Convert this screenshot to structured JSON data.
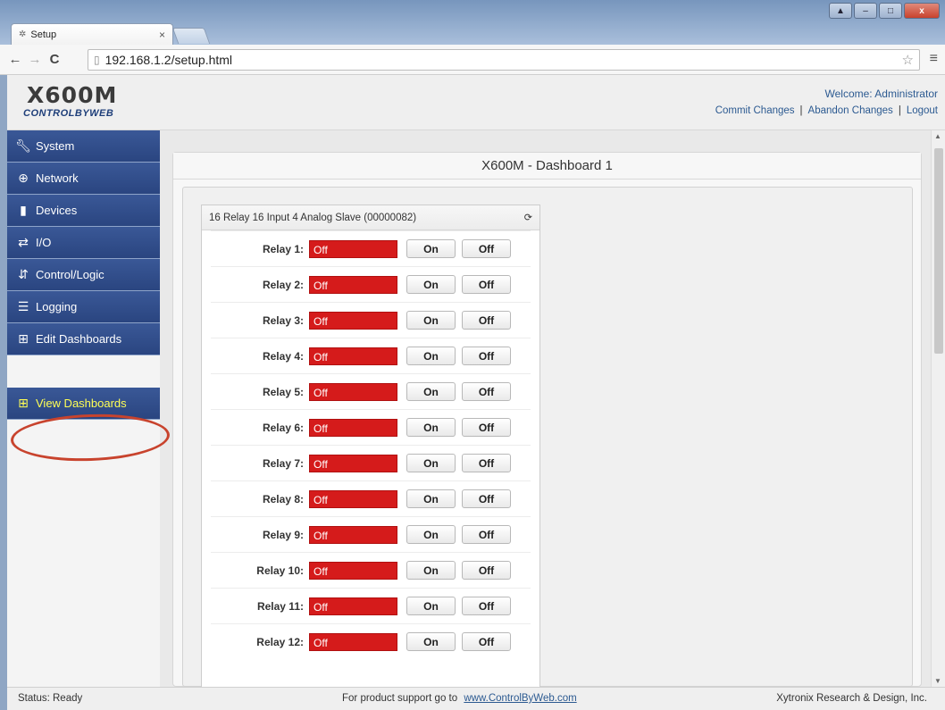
{
  "browser": {
    "tab_title": "Setup",
    "tab_close": "×",
    "url": "192.168.1.2/setup.html",
    "win_controls": [
      "▲",
      "–",
      "□",
      "x"
    ]
  },
  "header": {
    "logo_model": "X600M",
    "logo_brand": "CONTROLBYWEB",
    "welcome": "Welcome: Administrator",
    "links": [
      "Commit Changes",
      "Abandon Changes",
      "Logout"
    ],
    "separator": "|"
  },
  "sidebar": {
    "items": [
      {
        "label": "System",
        "icon": "wrench-icon"
      },
      {
        "label": "Network",
        "icon": "globe-icon"
      },
      {
        "label": "Devices",
        "icon": "device-icon"
      },
      {
        "label": "I/O",
        "icon": "io-arrows-icon"
      },
      {
        "label": "Control/Logic",
        "icon": "logic-icon"
      },
      {
        "label": "Logging",
        "icon": "log-icon"
      },
      {
        "label": "Edit Dashboards",
        "icon": "dashboard-icon"
      }
    ],
    "view_dashboards": {
      "label": "View Dashboards",
      "icon": "dashboard-icon"
    }
  },
  "dashboard": {
    "title": "X600M - Dashboard 1",
    "widget_title": "16 Relay 16 Input 4 Analog Slave (00000082)",
    "relays": [
      {
        "label": "Relay 1:",
        "state": "Off"
      },
      {
        "label": "Relay 2:",
        "state": "Off"
      },
      {
        "label": "Relay 3:",
        "state": "Off"
      },
      {
        "label": "Relay 4:",
        "state": "Off"
      },
      {
        "label": "Relay 5:",
        "state": "Off"
      },
      {
        "label": "Relay 6:",
        "state": "Off"
      },
      {
        "label": "Relay 7:",
        "state": "Off"
      },
      {
        "label": "Relay 8:",
        "state": "Off"
      },
      {
        "label": "Relay 9:",
        "state": "Off"
      },
      {
        "label": "Relay 10:",
        "state": "Off"
      },
      {
        "label": "Relay 11:",
        "state": "Off"
      },
      {
        "label": "Relay 12:",
        "state": "Off"
      }
    ],
    "on_label": "On",
    "off_label": "Off"
  },
  "status": {
    "status_text": "Status:  Ready",
    "support_text": "For product support go to",
    "support_link": "www.ControlByWeb.com",
    "company": "Xytronix Research & Design, Inc."
  },
  "colors": {
    "nav_blue": "#2f4c8c",
    "relay_off_red": "#d51b1b",
    "link_blue": "#2c5a91",
    "highlight_ring": "#c8432d",
    "view_dashboards_text": "#ffff55"
  }
}
